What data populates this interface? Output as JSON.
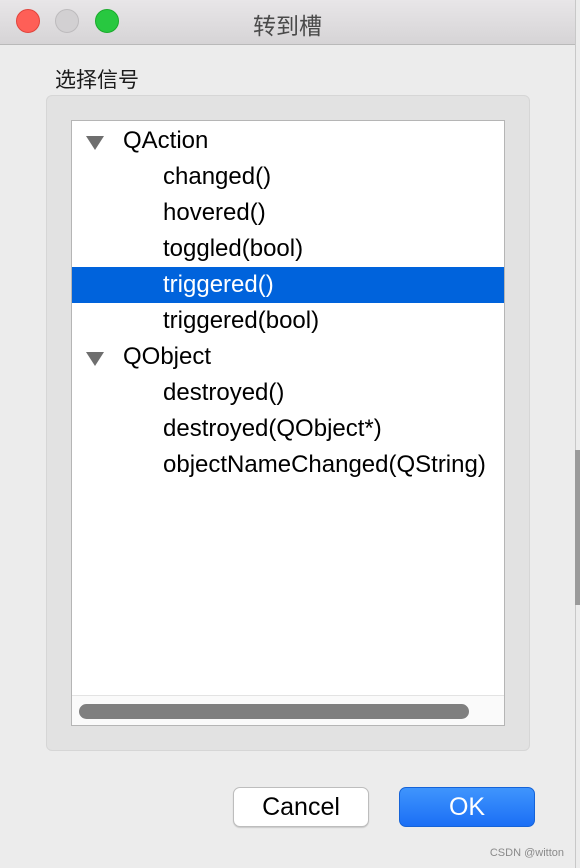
{
  "window": {
    "title": "转到槽"
  },
  "group": {
    "label": "选择信号"
  },
  "tree": [
    {
      "kind": "top",
      "label": "QAction"
    },
    {
      "kind": "child",
      "label": "changed()"
    },
    {
      "kind": "child",
      "label": "hovered()"
    },
    {
      "kind": "child",
      "label": "toggled(bool)"
    },
    {
      "kind": "child",
      "label": "triggered()",
      "selected": true
    },
    {
      "kind": "child",
      "label": "triggered(bool)"
    },
    {
      "kind": "top",
      "label": "QObject"
    },
    {
      "kind": "child",
      "label": "destroyed()"
    },
    {
      "kind": "child",
      "label": "destroyed(QObject*)"
    },
    {
      "kind": "child",
      "label": "objectNameChanged(QString)"
    }
  ],
  "buttons": {
    "cancel": "Cancel",
    "ok": "OK"
  },
  "watermark": "CSDN @witton",
  "colors": {
    "selection": "#0063dc",
    "ok_button": "#1b6ff5"
  }
}
